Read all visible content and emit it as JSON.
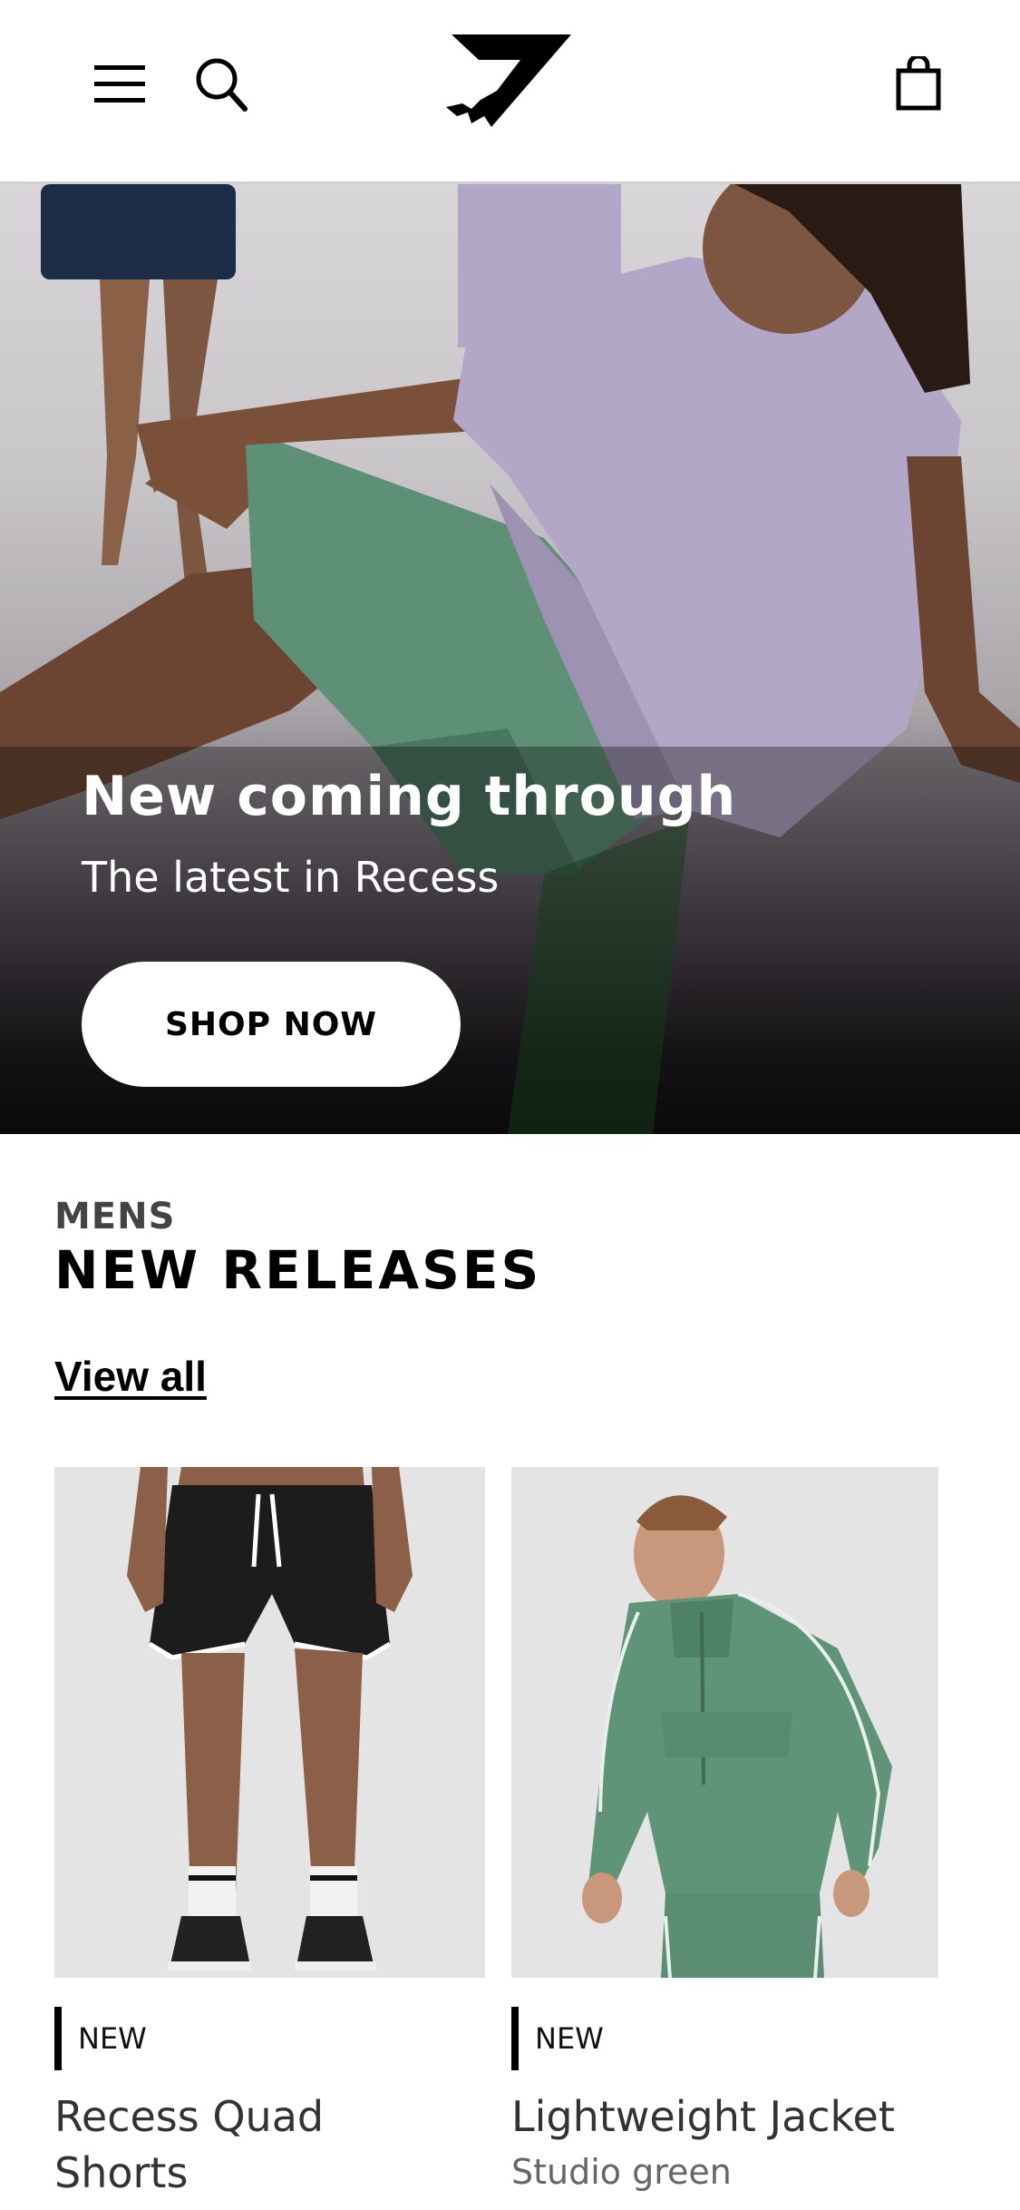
{
  "header": {
    "menu_icon": "hamburger-menu-icon",
    "search_icon": "search-icon",
    "logo": "gymshark-shark-logo",
    "bag_icon": "shopping-bag-icon"
  },
  "hero": {
    "title": "New coming through",
    "subtitle": "The latest in Recess",
    "cta_label": "SHOP NOW"
  },
  "section": {
    "kicker": "MENS",
    "title": "NEW RELEASES",
    "view_all": "View all"
  },
  "products": [
    {
      "badge": "NEW",
      "name_line1": "Recess Quad",
      "name_line2": "Shorts",
      "color": ""
    },
    {
      "badge": "NEW",
      "name_line1": "Lightweight Jacket",
      "name_line2": "",
      "color": "Studio green"
    }
  ],
  "colors": {
    "hero_shirt": "#b3a7c7",
    "shorts_green": "#5e9077",
    "jacket_green": "#5f9478",
    "image_bg": "#e4e4e4"
  }
}
